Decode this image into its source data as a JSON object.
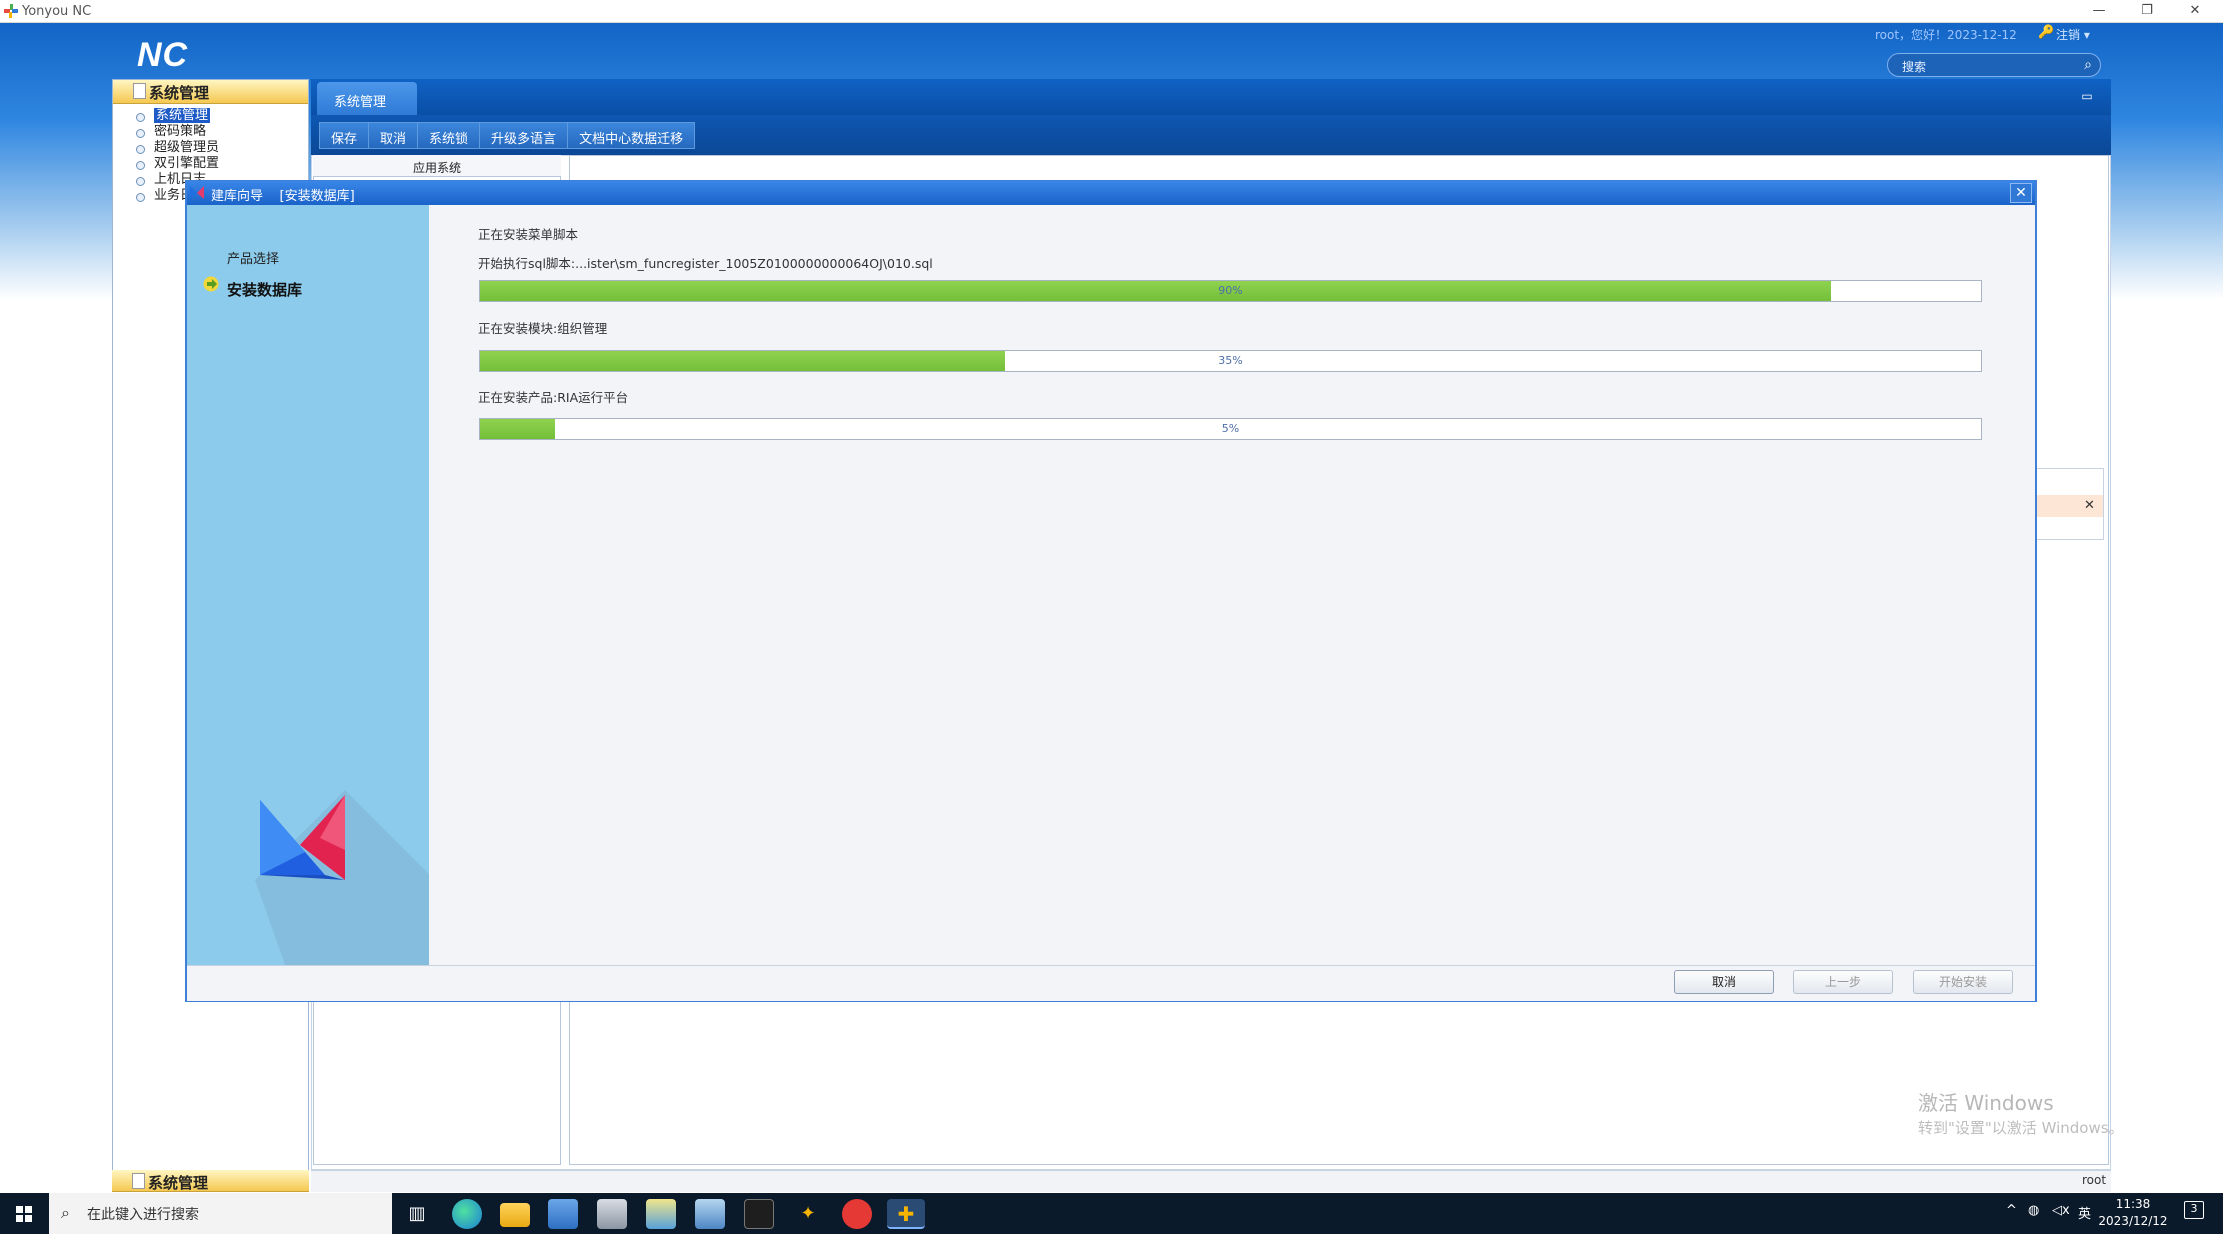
{
  "window": {
    "title": "Yonyou NC",
    "controls": [
      "—",
      "❐",
      "✕"
    ]
  },
  "header": {
    "logo": "NC",
    "user_line": "root，您好！2023-12-12",
    "logout": "注销",
    "search_placeholder": "搜索"
  },
  "left_panel": {
    "title": "系统管理",
    "items": [
      {
        "label": "系统管理",
        "selected": true
      },
      {
        "label": "密码策略"
      },
      {
        "label": "超级管理员"
      },
      {
        "label": "双引擎配置"
      },
      {
        "label": "上机日志"
      },
      {
        "label": "业务日志"
      }
    ],
    "bottom_title": "系统管理"
  },
  "main": {
    "tab": "系统管理",
    "toolbar": [
      "保存",
      "取消",
      "系统锁",
      "升级多语言",
      "文档中心数据迁移"
    ],
    "app_tab": "应用系统",
    "status_user": "root"
  },
  "dialog": {
    "title": "建库向导",
    "title_bracket": "[安装数据库]",
    "steps": [
      {
        "label": "产品选择",
        "active": false
      },
      {
        "label": "安装数据库",
        "active": true
      }
    ],
    "progress": [
      {
        "heading": "正在安装菜单脚本",
        "detail": "开始执行sql脚本:...ister\\sm_funcregister_1005Z0100000000064OJ\\010.sql",
        "percent": 90,
        "label": "90%"
      },
      {
        "heading": "正在安装模块:组织管理",
        "percent": 35,
        "label": "35%"
      },
      {
        "heading": "正在安装产品:RIA运行平台",
        "percent": 5,
        "label": "5%"
      }
    ],
    "buttons": {
      "cancel": "取消",
      "prev": "上一步",
      "install": "开始安装"
    }
  },
  "watermark": {
    "line1": "激活 Windows",
    "line2": "转到\"设置\"以激活 Windows。"
  },
  "taskbar": {
    "search_placeholder": "在此键入进行搜索",
    "ime": "英",
    "time": "11:38",
    "date": "2023/12/12",
    "notifications": "3"
  },
  "colors": {
    "progress_fill": "#7cc443",
    "dialog_border": "#3e7fd8",
    "panel_header": "#f5c851"
  }
}
